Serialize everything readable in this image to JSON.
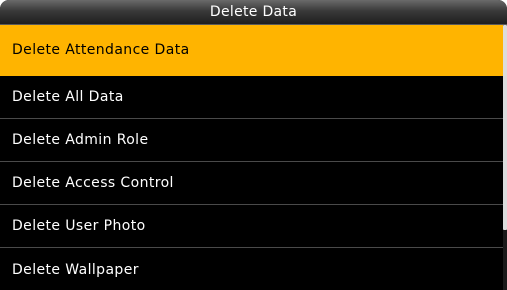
{
  "header": {
    "title": "Delete Data"
  },
  "menu": {
    "selected_index": 0,
    "items": [
      {
        "label": "Delete Attendance Data"
      },
      {
        "label": "Delete All Data"
      },
      {
        "label": "Delete Admin Role"
      },
      {
        "label": "Delete Access Control"
      },
      {
        "label": "Delete User Photo"
      },
      {
        "label": "Delete Wallpaper"
      }
    ]
  },
  "colors": {
    "selected_background": "#ffb400",
    "background": "#000000",
    "text": "#ffffff"
  }
}
